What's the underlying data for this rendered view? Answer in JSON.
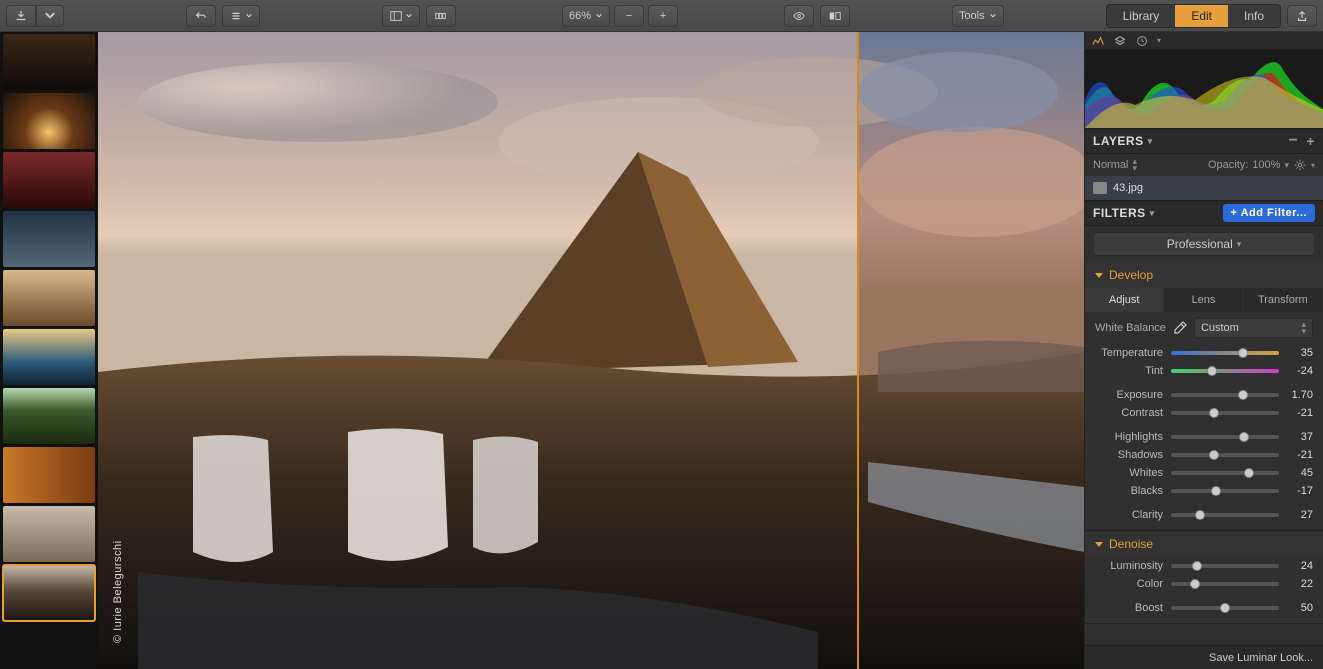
{
  "toolbar": {
    "zoom_level": "66%",
    "tools_label": "Tools",
    "tabs": {
      "library": "Library",
      "edit": "Edit",
      "info": "Info"
    }
  },
  "canvas": {
    "credit": "© Iurie Belegurschi"
  },
  "layers": {
    "title": "LAYERS",
    "blend_mode": "Normal",
    "opacity_label": "Opacity:",
    "opacity_value": "100%",
    "item_name": "43.jpg"
  },
  "filters": {
    "title": "FILTERS",
    "add_label": "+ Add Filter...",
    "preset": "Professional",
    "develop": {
      "title": "Develop",
      "tabs": {
        "adjust": "Adjust",
        "lens": "Lens",
        "transform": "Transform"
      },
      "wb_label": "White Balance",
      "wb_value": "Custom",
      "sliders": {
        "temperature": {
          "label": "Temperature",
          "value": "35",
          "pos": 67
        },
        "tint": {
          "label": "Tint",
          "value": "-24",
          "pos": 38
        },
        "exposure": {
          "label": "Exposure",
          "value": "1.70",
          "pos": 67
        },
        "contrast": {
          "label": "Contrast",
          "value": "-21",
          "pos": 40
        },
        "highlights": {
          "label": "Highlights",
          "value": "37",
          "pos": 68
        },
        "shadows": {
          "label": "Shadows",
          "value": "-21",
          "pos": 40
        },
        "whites": {
          "label": "Whites",
          "value": "45",
          "pos": 72
        },
        "blacks": {
          "label": "Blacks",
          "value": "-17",
          "pos": 42
        },
        "clarity": {
          "label": "Clarity",
          "value": "27",
          "pos": 27
        }
      }
    },
    "denoise": {
      "title": "Denoise",
      "sliders": {
        "luminosity": {
          "label": "Luminosity",
          "value": "24",
          "pos": 24
        },
        "color": {
          "label": "Color",
          "value": "22",
          "pos": 22
        },
        "boost": {
          "label": "Boost",
          "value": "50",
          "pos": 50
        }
      }
    }
  },
  "footer": {
    "save_look": "Save Luminar Look..."
  }
}
